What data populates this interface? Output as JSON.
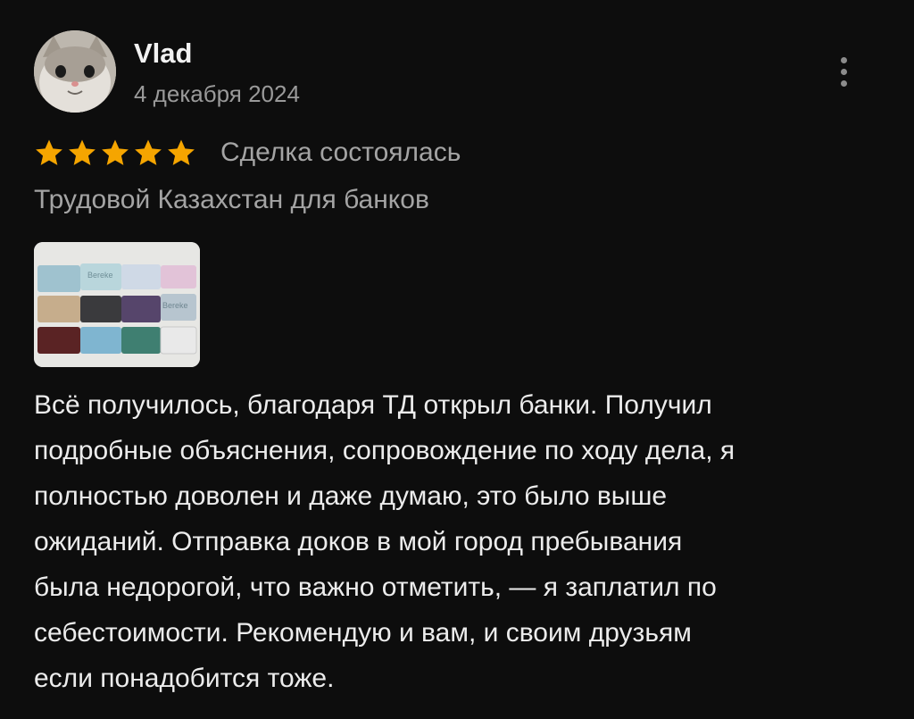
{
  "review": {
    "author": "Vlad",
    "date": "4 декабря 2024",
    "rating": 5,
    "rating_max": 5,
    "deal_status": "Сделка состоялась",
    "service": "Трудовой Казахстан для банков",
    "text_lines": [
      "Всё получилось, благодаря ТД открыл банки. Получил",
      "подробные объяснения, сопровождение по ходу дела, я",
      "полностью доволен и даже думаю, это было выше",
      "ожиданий. Отправка доков в мой город пребывания",
      "была недорогой, что важно отметить, — я заплатил по",
      "себестоимости. Рекомендую и вам, и своим друзьям",
      "если понадобится тоже."
    ],
    "photo_card_text": [
      "Bereke",
      "Bereke"
    ]
  },
  "icons": {
    "menu": "more-vertical-icon",
    "star": "star-icon"
  },
  "colors": {
    "background": "#0d0d0d",
    "star": "#f5a500",
    "secondary_text": "#a4a4a4",
    "primary_text": "#ececec"
  }
}
